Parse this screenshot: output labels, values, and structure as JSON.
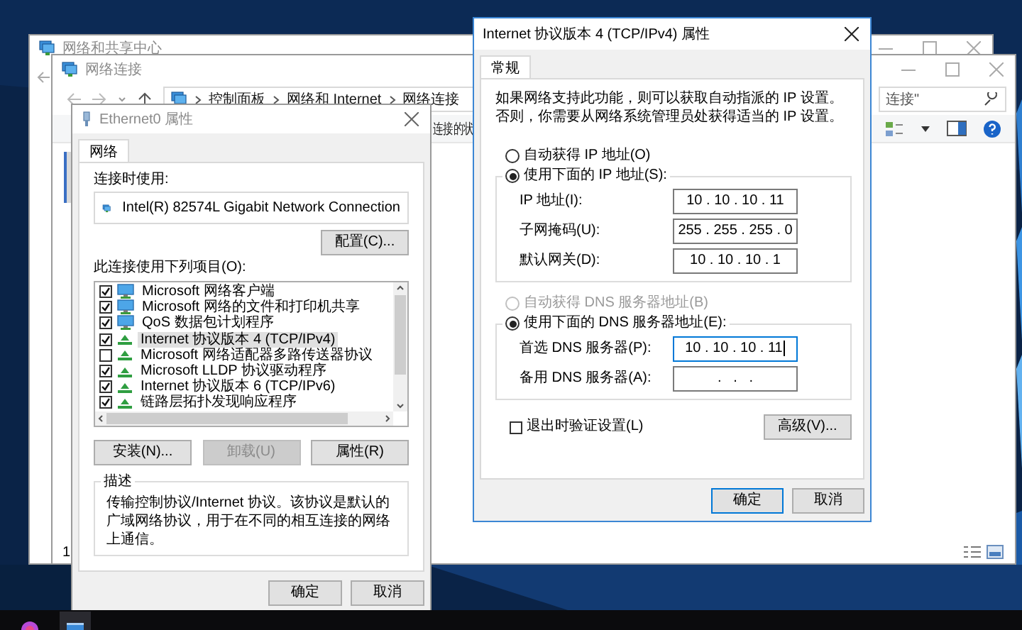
{
  "back_window": {
    "title": "网络和共享中心"
  },
  "explorer": {
    "title": "网络连接",
    "breadcrumb": [
      "控制面板",
      "网络和 Internet",
      "网络连接"
    ],
    "search_value": "连接\"",
    "toolbar_text": "连接的状",
    "status_count": "1"
  },
  "ethernet_dialog": {
    "title": "Ethernet0 属性",
    "tabs": [
      {
        "label": "网络",
        "selected": true
      }
    ],
    "connect_using_label": "连接时使用:",
    "adapter": "Intel(R) 82574L Gigabit Network Connection",
    "configure_button": "配置(C)...",
    "items_label": "此连接使用下列项目(O):",
    "items": [
      {
        "label": "Microsoft 网络客户端",
        "kind": "client",
        "checked": true,
        "selected": false
      },
      {
        "label": "Microsoft 网络的文件和打印机共享",
        "kind": "client",
        "checked": true,
        "selected": false
      },
      {
        "label": "QoS 数据包计划程序",
        "kind": "client",
        "checked": true,
        "selected": false
      },
      {
        "label": "Internet 协议版本 4 (TCP/IPv4)",
        "kind": "protocol",
        "checked": true,
        "selected": true
      },
      {
        "label": "Microsoft 网络适配器多路传送器协议",
        "kind": "protocol",
        "checked": false,
        "selected": false
      },
      {
        "label": "Microsoft LLDP 协议驱动程序",
        "kind": "protocol",
        "checked": true,
        "selected": false
      },
      {
        "label": "Internet 协议版本 6 (TCP/IPv6)",
        "kind": "protocol",
        "checked": true,
        "selected": false
      },
      {
        "label": "链路层拓扑发现响应程序",
        "kind": "protocol",
        "checked": true,
        "selected": false
      }
    ],
    "buttons": [
      {
        "label": "安装(N)...",
        "disabled": false
      },
      {
        "label": "卸载(U)",
        "disabled": true
      },
      {
        "label": "属性(R)",
        "disabled": false
      }
    ],
    "description_title": "描述",
    "description": "传输控制协议/Internet 协议。该协议是默认的广域网络协议，用于在不同的相互连接的网络上通信。",
    "footer_buttons": [
      "确定",
      "取消"
    ]
  },
  "ipv4_dialog": {
    "title": "Internet 协议版本 4 (TCP/IPv4) 属性",
    "tabs": [
      {
        "label": "常规",
        "selected": true
      }
    ],
    "intro": "如果网络支持此功能，则可以获取自动指派的 IP 设置。否则，你需要从网络系统管理员处获得适当的 IP 设置。",
    "ip_modes": [
      {
        "label": "自动获得 IP 地址(O)",
        "selected": false,
        "disabled": false
      },
      {
        "label": "使用下面的 IP 地址(S):",
        "selected": true,
        "disabled": false
      }
    ],
    "ip_fields": [
      {
        "label": "IP 地址(I):",
        "value": "10 . 10 . 10 . 11",
        "focused": false
      },
      {
        "label": "子网掩码(U):",
        "value": "255 . 255 . 255 . 0",
        "focused": false
      },
      {
        "label": "默认网关(D):",
        "value": "10 . 10 . 10 . 1",
        "focused": false
      }
    ],
    "dns_modes": [
      {
        "label": "自动获得 DNS 服务器地址(B)",
        "selected": false,
        "disabled": true
      },
      {
        "label": "使用下面的 DNS 服务器地址(E):",
        "selected": true,
        "disabled": false
      }
    ],
    "dns_fields": [
      {
        "label": "首选 DNS 服务器(P):",
        "value": "10 . 10 . 10 . 11",
        "focused": true
      },
      {
        "label": "备用 DNS 服务器(A):",
        "value": ".   .   .",
        "focused": false
      }
    ],
    "validate": {
      "label": "退出时验证设置(L)",
      "checked": false
    },
    "advanced_button": "高级(V)...",
    "footer_buttons": [
      {
        "label": "确定",
        "default": true
      },
      {
        "label": "取消",
        "default": false
      }
    ]
  }
}
